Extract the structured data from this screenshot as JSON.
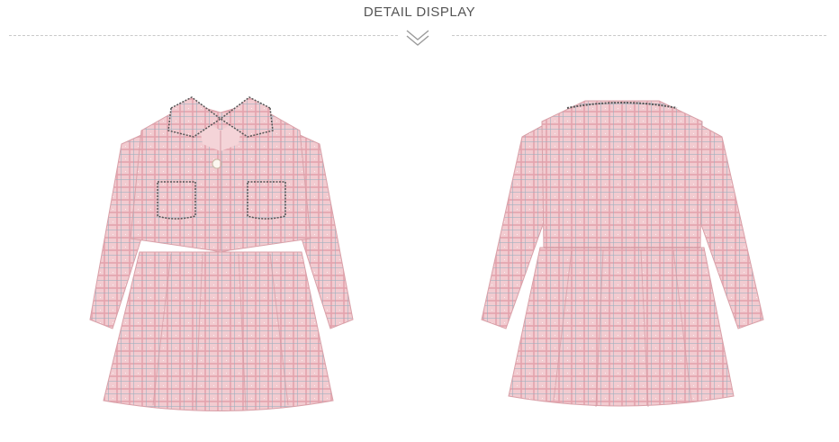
{
  "section": {
    "title": "DETAIL DISPLAY"
  },
  "colors": {
    "fabric": "#f1c9ce",
    "fabric_dark": "#e5a9b1",
    "trim": "#5b5b5b",
    "text": "#555555"
  },
  "images": [
    {
      "name": "dress-set-front",
      "view": "front"
    },
    {
      "name": "dress-set-back",
      "view": "back"
    }
  ]
}
